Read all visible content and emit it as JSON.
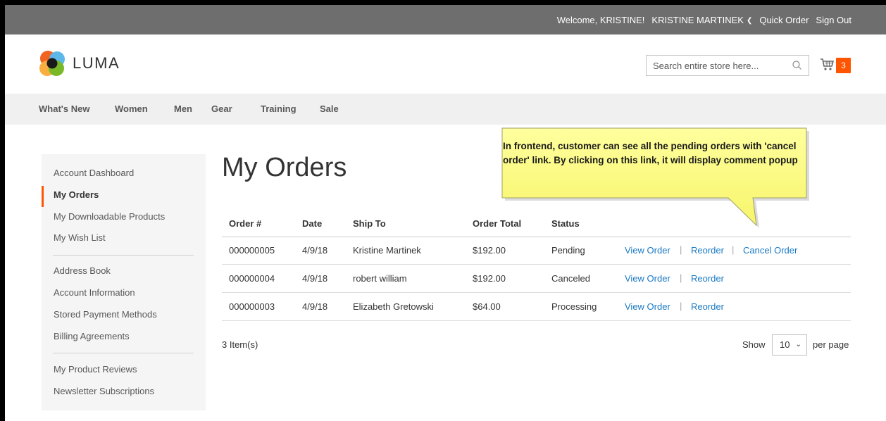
{
  "header": {
    "welcome": "Welcome, KRISTINE!",
    "customer_name": "KRISTINE MARTINEK",
    "quick_order": "Quick Order",
    "sign_out": "Sign Out"
  },
  "logo": {
    "text": "LUMA"
  },
  "search": {
    "placeholder": "Search entire store here..."
  },
  "cart": {
    "count": "3"
  },
  "nav": [
    "What's New",
    "Women",
    "Men",
    "Gear",
    "Training",
    "Sale"
  ],
  "sidebar": {
    "items": [
      "Account Dashboard",
      "My Orders",
      "My Downloadable Products",
      "My Wish List",
      "Address Book",
      "Account Information",
      "Stored Payment Methods",
      "Billing Agreements",
      "My Product Reviews",
      "Newsletter Subscriptions"
    ]
  },
  "page_title": "My Orders",
  "table": {
    "headers": [
      "Order #",
      "Date",
      "Ship To",
      "Order Total",
      "Status"
    ],
    "rows": [
      {
        "order": "000000005",
        "date": "4/9/18",
        "ship_to": "Kristine Martinek",
        "total": "$192.00",
        "status": "Pending",
        "actions": [
          "View Order",
          "Reorder",
          "Cancel Order"
        ]
      },
      {
        "order": "000000004",
        "date": "4/9/18",
        "ship_to": "robert william",
        "total": "$192.00",
        "status": "Canceled",
        "actions": [
          "View Order",
          "Reorder"
        ]
      },
      {
        "order": "000000003",
        "date": "4/9/18",
        "ship_to": "Elizabeth Gretowski",
        "total": "$64.00",
        "status": "Processing",
        "actions": [
          "View Order",
          "Reorder"
        ]
      }
    ]
  },
  "toolbar": {
    "item_count": "3 Item(s)",
    "show_label": "Show",
    "limit": "10",
    "per_page": "per page"
  },
  "callout": {
    "text": "In frontend, customer can see all the pending orders with 'cancel order' link. By clicking on this link, it will display comment popup"
  },
  "colors": {
    "accent": "#ff5501",
    "link": "#1979c3",
    "callout": "#ffff88",
    "topbar": "#6e6e6e"
  }
}
